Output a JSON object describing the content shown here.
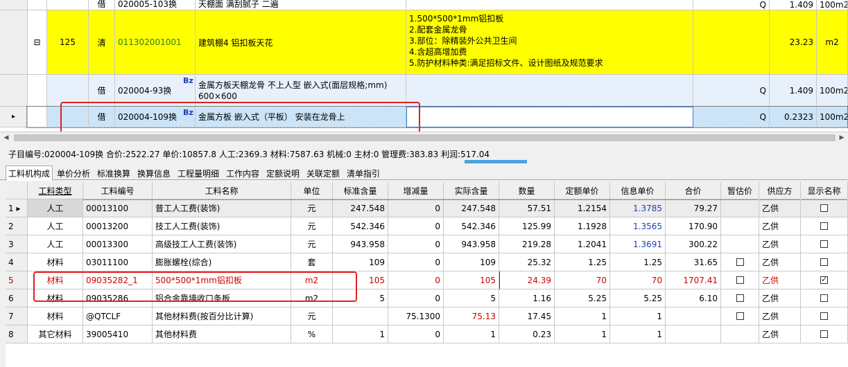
{
  "top_rows": [
    {
      "seq": "",
      "type": "借",
      "code": "020005-103换",
      "name": "天棚面 满刮腻子 二遍",
      "desc": "",
      "q": "Q",
      "qty": "1.409",
      "unit": "100m2",
      "style": "plain"
    },
    {
      "seq": "125",
      "type": "清",
      "code": "011302001001",
      "name": "建筑棚4 铝扣板天花",
      "desc": [
        "1.500*500*1mm铝扣板",
        "2.配套金属龙骨",
        "3.部位：除精装外公共卫生间",
        "4.含超高增加费",
        "5.防护材料种类:满足招标文件、设计图纸及规范要求"
      ],
      "q": "",
      "qty": "23.23",
      "unit": "m2",
      "style": "yellow",
      "tree": "⊟"
    },
    {
      "seq": "",
      "type": "借",
      "code": "020004-93换",
      "name": "金属方板天棚龙骨 不上人型 嵌入式(面层规格;mm) 600×600",
      "desc": "",
      "q": "Q",
      "qty": "1.409",
      "unit": "100m2",
      "style": "lblue",
      "badge": "Bz"
    },
    {
      "seq": "",
      "type": "借",
      "code": "020004-109换",
      "name": "金属方板 嵌入式（平板） 安装在龙骨上",
      "desc": "",
      "q": "Q",
      "qty": "0.2323",
      "unit": "100m2",
      "style": "selected",
      "badge": "Bz",
      "pointer": "▸"
    }
  ],
  "summary": "子目编号:020004-109换 合价:2522.27 单价:10857.8 人工:2369.3 材料:7587.63 机械:0 主材:0 管理费:383.83 利润:517.04",
  "tabs": [
    "工料机构成",
    "单价分析",
    "标准换算",
    "换算信息",
    "工程量明细",
    "工作内容",
    "定额说明",
    "关联定额",
    "清单指引"
  ],
  "headers": [
    "工料类型",
    "工料编号",
    "工料名称",
    "单位",
    "标准含量",
    "增减量",
    "实际含量",
    "数量",
    "定额单价",
    "信息单价",
    "合价",
    "暂估价",
    "供应方",
    "显示名称"
  ],
  "rows": [
    {
      "n": "1",
      "pointer": "▸",
      "type": "人工",
      "code": "00013100",
      "name": "普工人工费(装饰)",
      "unit": "元",
      "std": "247.548",
      "delta": "0",
      "actual": "247.548",
      "qty": "57.51",
      "price": "1.2154",
      "info": "1.3785",
      "total": "79.27",
      "est": false,
      "supplier": "乙供",
      "show": false,
      "showEst": false,
      "style": "sel"
    },
    {
      "n": "2",
      "type": "人工",
      "code": "00013200",
      "name": "技工人工费(装饰)",
      "unit": "元",
      "std": "542.346",
      "delta": "0",
      "actual": "542.346",
      "qty": "125.99",
      "price": "1.1928",
      "info": "1.3565",
      "total": "170.90",
      "supplier": "乙供",
      "show": false,
      "showEst": false
    },
    {
      "n": "3",
      "type": "人工",
      "code": "00013300",
      "name": "高级技工人工费(装饰)",
      "unit": "元",
      "std": "943.958",
      "delta": "0",
      "actual": "943.958",
      "qty": "219.28",
      "price": "1.2041",
      "info": "1.3691",
      "total": "300.22",
      "supplier": "乙供",
      "show": false,
      "showEst": false
    },
    {
      "n": "4",
      "type": "材料",
      "code": "03011100",
      "name": "膨胀螺栓(综合)",
      "unit": "套",
      "std": "109",
      "delta": "0",
      "actual": "109",
      "qty": "25.32",
      "price": "1.25",
      "info": "1.25",
      "total": "31.65",
      "supplier": "乙供",
      "show": false,
      "showEst": true
    },
    {
      "n": "5",
      "type": "材料",
      "code": "09035282_1",
      "name": "500*500*1mm铝扣板",
      "unit": "m2",
      "std": "105",
      "delta": "0",
      "actual": "105",
      "qty": "24.39",
      "price": "70",
      "info": "70",
      "total": "1707.41",
      "supplier": "乙供",
      "show": true,
      "showEst": true,
      "style": "red"
    },
    {
      "n": "6",
      "type": "材料",
      "code": "09035286",
      "name": "铝合金靠墙收口条板",
      "unit": "m2",
      "std": "5",
      "delta": "0",
      "actual": "5",
      "qty": "1.16",
      "price": "5.25",
      "info": "5.25",
      "total": "6.10",
      "supplier": "乙供",
      "show": false,
      "showEst": true
    },
    {
      "n": "7",
      "type": "材料",
      "code": "@QTCLF",
      "name": "其他材料费(按百分比计算)",
      "unit": "元",
      "std": "",
      "delta": "75.1300",
      "actual": "75.13",
      "qty": "17.45",
      "price": "1",
      "info": "1",
      "total": "",
      "supplier": "乙供",
      "show": false,
      "showEst": true,
      "redActual": true
    },
    {
      "n": "8",
      "type": "其它材料",
      "code": "39005410",
      "name": "其他材料费",
      "unit": "%",
      "std": "1",
      "delta": "0",
      "actual": "1",
      "qty": "0.23",
      "price": "1",
      "info": "1",
      "total": "",
      "supplier": "乙供",
      "show": false,
      "showEst": false
    }
  ],
  "colors": {
    "accent": "#4aa3df",
    "highlight": "#ffff00",
    "selection": "#cce4f7",
    "annotation": "#e02020",
    "link_value": "#1c3fb8"
  }
}
